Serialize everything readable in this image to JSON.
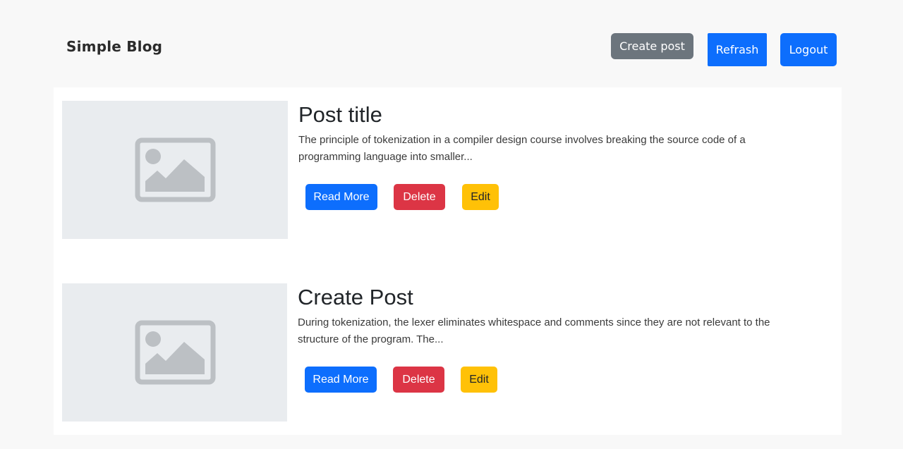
{
  "navbar": {
    "brand": "Simple Blog",
    "create_post_label": "Create post",
    "refresh_label": "Refrash",
    "logout_label": "Logout"
  },
  "posts": [
    {
      "title": "Post title",
      "excerpt": "The principle of tokenization in a compiler design course involves breaking the source code of a programming language into smaller...",
      "read_more_label": "Read More",
      "delete_label": "Delete",
      "edit_label": "Edit",
      "thumbnail_icon": "image-placeholder-icon"
    },
    {
      "title": "Create Post",
      "excerpt": "During tokenization, the lexer eliminates whitespace and comments since they are not relevant to the structure of the program. The...",
      "read_more_label": "Read More",
      "delete_label": "Delete",
      "edit_label": "Edit",
      "thumbnail_icon": "image-placeholder-icon"
    }
  ],
  "colors": {
    "primary": "#0d6efd",
    "secondary": "#6c757d",
    "danger": "#dc3545",
    "warning": "#ffc107",
    "placeholder_bg": "#e9ecef",
    "page_bg": "#f8f8f8"
  }
}
